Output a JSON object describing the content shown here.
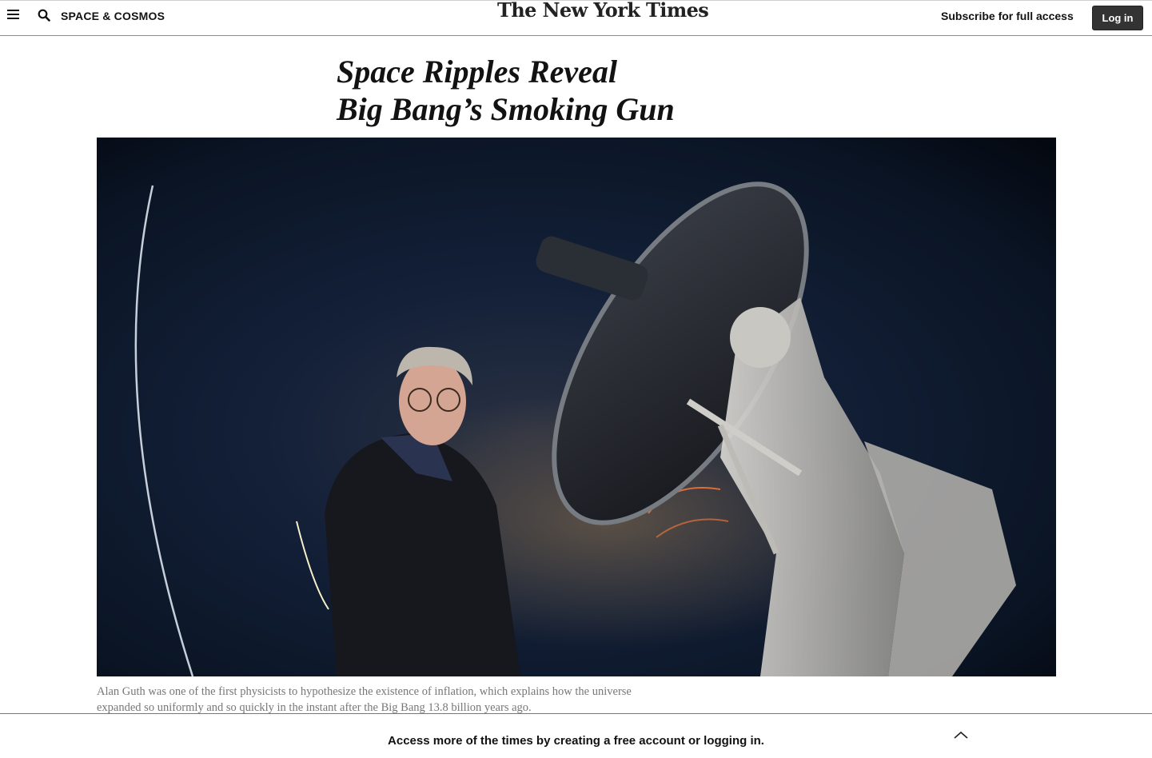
{
  "header": {
    "menu_icon": "hamburger-menu-icon",
    "search_icon": "search-icon",
    "section": "SPACE & COSMOS",
    "masthead": "The New York Times",
    "subscribe": "Subscribe for full access",
    "login": "Log in"
  },
  "article": {
    "headline_line1": "Space Ripples Reveal",
    "headline_line2": "Big Bang’s Smoking Gun",
    "caption": "Alan Guth was one of the first physicists to hypothesize the existence of inflation, which explains how the universe expanded so uniformly and so quickly in the instant after the Big Bang 13.8 billion years ago."
  },
  "banner": {
    "text": "Access more of the times by creating a free account or logging in.",
    "collapse_icon": "chevron-up-icon"
  },
  "colors": {
    "login_bg": "#333333",
    "text": "#121212",
    "caption": "#777777",
    "photo_sky": "#0c1526"
  }
}
